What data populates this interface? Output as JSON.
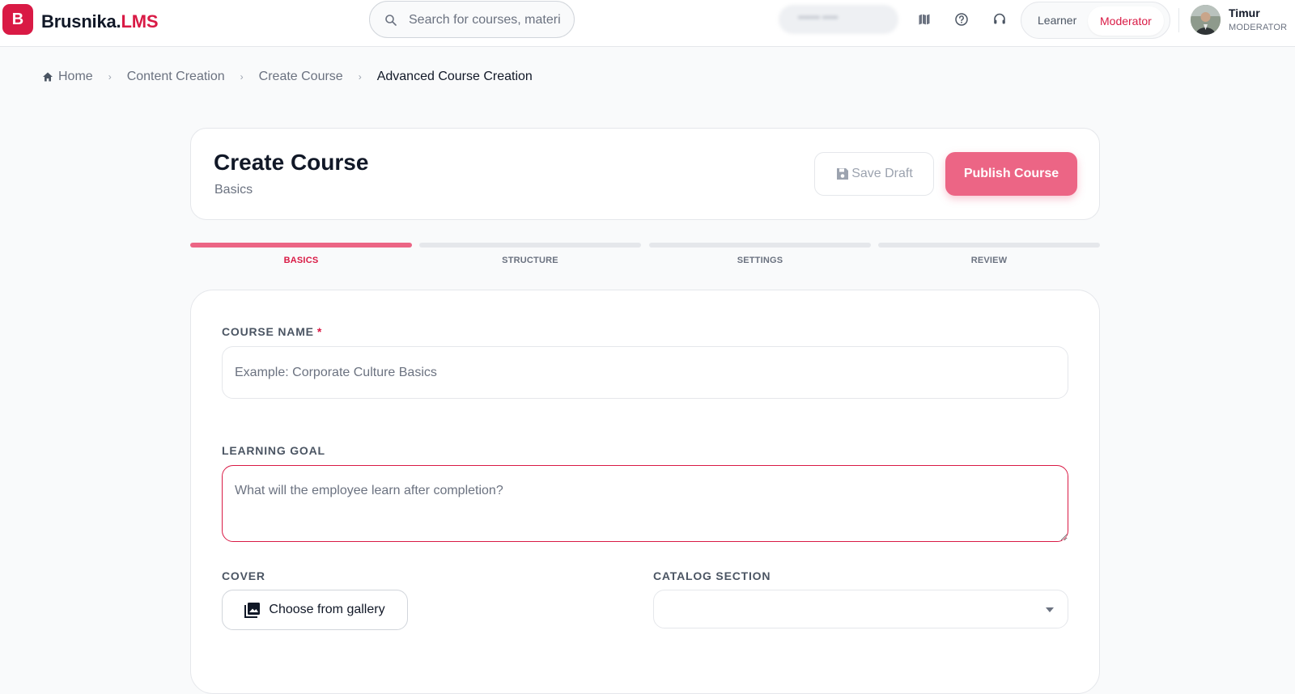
{
  "app": {
    "logo_letter": "B",
    "name_main": "Brusnika.",
    "name_accent": "LMS",
    "brand_color": "#d91a45"
  },
  "header": {
    "search": {
      "placeholder": "Search for courses, materi",
      "icon": "search-icon"
    },
    "icons": [
      "map-icon",
      "help-circle-icon",
      "headset-icon"
    ],
    "role_switch": {
      "learner": "Learner",
      "moderator": "Moderator",
      "selected": "Moderator"
    },
    "user": {
      "name": "Timur",
      "role": "MODERATOR"
    }
  },
  "breadcrumb": {
    "items": [
      "Home",
      "Content Creation",
      "Create Course",
      "Advanced Course Creation"
    ]
  },
  "title_card": {
    "title": "Create Course",
    "subtitle": "Basics",
    "save_draft": "Save Draft",
    "publish": "Publish Course"
  },
  "steps": [
    {
      "label": "BASICS",
      "active": true
    },
    {
      "label": "STRUCTURE",
      "active": false
    },
    {
      "label": "SETTINGS",
      "active": false
    },
    {
      "label": "REVIEW",
      "active": false
    }
  ],
  "form": {
    "course_name": {
      "label": "COURSE NAME",
      "required_mark": "*",
      "placeholder": "Example: Corporate Culture Basics",
      "value": ""
    },
    "learning_goal": {
      "label": "LEARNING GOAL",
      "placeholder": "What will the employee learn after completion?",
      "value": ""
    },
    "cover": {
      "label": "COVER",
      "button": "Choose from gallery"
    },
    "catalog_section": {
      "label": "CATALOG SECTION",
      "value": ""
    }
  }
}
